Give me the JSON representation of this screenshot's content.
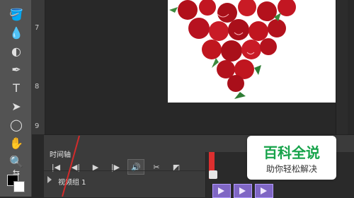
{
  "timeline": {
    "title": "时间轴",
    "track_name": "视频组 1"
  },
  "ruler": {
    "numbers": [
      "7",
      "8",
      "9"
    ]
  },
  "watermark": {
    "brand": "百科全说",
    "tagline": "助你轻松解决"
  },
  "colors": {
    "canvas": "#ffffff",
    "clip": "#7f66c4",
    "accent": "#16a34a"
  },
  "icons": [
    "paint-bucket-icon",
    "blur-icon",
    "dodge-icon",
    "pen-icon",
    "type-icon",
    "path-select-icon",
    "ellipse-icon",
    "hand-icon",
    "zoom-icon",
    "swap-colors-icon",
    "first-frame-icon",
    "prev-frame-icon",
    "play-icon",
    "next-frame-icon",
    "audio-icon",
    "split-icon",
    "transition-icon"
  ]
}
